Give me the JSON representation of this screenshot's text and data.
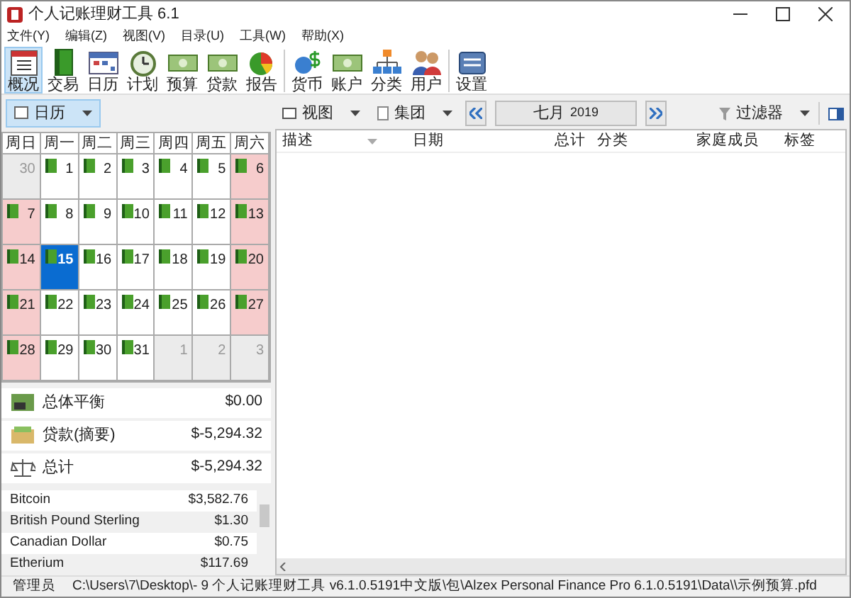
{
  "window": {
    "title": "个人记账理财工具 6.1"
  },
  "menu": [
    "文件(Y)",
    "编辑(Z)",
    "视图(V)",
    "目录(U)",
    "工具(W)",
    "帮助(X)"
  ],
  "toolbar": [
    {
      "label": "概况",
      "selected": true,
      "kind": "overview"
    },
    {
      "label": "交易",
      "selected": false,
      "kind": "book"
    },
    {
      "label": "日历",
      "selected": false,
      "kind": "calendar"
    },
    {
      "label": "计划",
      "selected": false,
      "kind": "clock"
    },
    {
      "label": "预算",
      "selected": false,
      "kind": "money"
    },
    {
      "label": "贷款",
      "selected": false,
      "kind": "money"
    },
    {
      "label": "报告",
      "selected": false,
      "kind": "pie"
    },
    {
      "label": "货币",
      "selected": false,
      "kind": "currency"
    },
    {
      "label": "账户",
      "selected": false,
      "kind": "money"
    },
    {
      "label": "分类",
      "selected": false,
      "kind": "tree"
    },
    {
      "label": "用户",
      "selected": false,
      "kind": "users"
    },
    {
      "label": "设置",
      "selected": false,
      "kind": "settings"
    }
  ],
  "left_toolbar": {
    "calendar_button": "日历"
  },
  "right_toolbar": {
    "view_button": "视图",
    "group_button": "集团",
    "month": "七月",
    "year": "2019",
    "filter_button": "过滤器"
  },
  "calendar": {
    "weekdays": [
      "周日",
      "周一",
      "周二",
      "周三",
      "周四",
      "周五",
      "周六"
    ],
    "weeks": [
      [
        {
          "day": "30",
          "muted": true,
          "weekend": false,
          "selected": false,
          "entry": false
        },
        {
          "day": "1",
          "muted": false,
          "weekend": false,
          "selected": false,
          "entry": true
        },
        {
          "day": "2",
          "muted": false,
          "weekend": false,
          "selected": false,
          "entry": true
        },
        {
          "day": "3",
          "muted": false,
          "weekend": false,
          "selected": false,
          "entry": true
        },
        {
          "day": "4",
          "muted": false,
          "weekend": false,
          "selected": false,
          "entry": true
        },
        {
          "day": "5",
          "muted": false,
          "weekend": false,
          "selected": false,
          "entry": true
        },
        {
          "day": "6",
          "muted": false,
          "weekend": true,
          "selected": false,
          "entry": true
        }
      ],
      [
        {
          "day": "7",
          "muted": false,
          "weekend": true,
          "selected": false,
          "entry": true
        },
        {
          "day": "8",
          "muted": false,
          "weekend": false,
          "selected": false,
          "entry": true
        },
        {
          "day": "9",
          "muted": false,
          "weekend": false,
          "selected": false,
          "entry": true
        },
        {
          "day": "10",
          "muted": false,
          "weekend": false,
          "selected": false,
          "entry": true
        },
        {
          "day": "11",
          "muted": false,
          "weekend": false,
          "selected": false,
          "entry": true
        },
        {
          "day": "12",
          "muted": false,
          "weekend": false,
          "selected": false,
          "entry": true
        },
        {
          "day": "13",
          "muted": false,
          "weekend": true,
          "selected": false,
          "entry": true
        }
      ],
      [
        {
          "day": "14",
          "muted": false,
          "weekend": true,
          "selected": false,
          "entry": true
        },
        {
          "day": "15",
          "muted": false,
          "weekend": false,
          "selected": true,
          "entry": true
        },
        {
          "day": "16",
          "muted": false,
          "weekend": false,
          "selected": false,
          "entry": true
        },
        {
          "day": "17",
          "muted": false,
          "weekend": false,
          "selected": false,
          "entry": true
        },
        {
          "day": "18",
          "muted": false,
          "weekend": false,
          "selected": false,
          "entry": true
        },
        {
          "day": "19",
          "muted": false,
          "weekend": false,
          "selected": false,
          "entry": true
        },
        {
          "day": "20",
          "muted": false,
          "weekend": true,
          "selected": false,
          "entry": true
        }
      ],
      [
        {
          "day": "21",
          "muted": false,
          "weekend": true,
          "selected": false,
          "entry": true
        },
        {
          "day": "22",
          "muted": false,
          "weekend": false,
          "selected": false,
          "entry": true
        },
        {
          "day": "23",
          "muted": false,
          "weekend": false,
          "selected": false,
          "entry": true
        },
        {
          "day": "24",
          "muted": false,
          "weekend": false,
          "selected": false,
          "entry": true
        },
        {
          "day": "25",
          "muted": false,
          "weekend": false,
          "selected": false,
          "entry": true
        },
        {
          "day": "26",
          "muted": false,
          "weekend": false,
          "selected": false,
          "entry": true
        },
        {
          "day": "27",
          "muted": false,
          "weekend": true,
          "selected": false,
          "entry": true
        }
      ],
      [
        {
          "day": "28",
          "muted": false,
          "weekend": true,
          "selected": false,
          "entry": true
        },
        {
          "day": "29",
          "muted": false,
          "weekend": false,
          "selected": false,
          "entry": true
        },
        {
          "day": "30",
          "muted": false,
          "weekend": false,
          "selected": false,
          "entry": true
        },
        {
          "day": "31",
          "muted": false,
          "weekend": false,
          "selected": false,
          "entry": true
        },
        {
          "day": "1",
          "muted": true,
          "weekend": false,
          "selected": false,
          "entry": false
        },
        {
          "day": "2",
          "muted": true,
          "weekend": false,
          "selected": false,
          "entry": false
        },
        {
          "day": "3",
          "muted": true,
          "weekend": false,
          "selected": false,
          "entry": false
        }
      ]
    ]
  },
  "summary": [
    {
      "kind": "balance",
      "label": "总体平衡",
      "amount": "$0.00"
    },
    {
      "kind": "loan",
      "label": "贷款(摘要)",
      "amount": "$-5,294.32"
    },
    {
      "kind": "total",
      "label": "总计",
      "amount": "$-5,294.32"
    }
  ],
  "currencies": [
    {
      "name": "Bitcoin",
      "value": "$3,582.76"
    },
    {
      "name": "British Pound Sterling",
      "value": "$1.30"
    },
    {
      "name": "Canadian Dollar",
      "value": "$0.75"
    },
    {
      "name": "Etherium",
      "value": "$117.69"
    }
  ],
  "table": {
    "columns": [
      "描述",
      "日期",
      "总计",
      "分类",
      "家庭成员",
      "标签"
    ]
  },
  "status_bar": {
    "user": "管理员",
    "path": "C:\\Users\\7\\Desktop\\-  9 个人记账理财工具 v6.1.0.5191中文版\\包\\Alzex Personal Finance Pro 6.1.0.5191\\Data\\\\示例预算.pfd"
  }
}
